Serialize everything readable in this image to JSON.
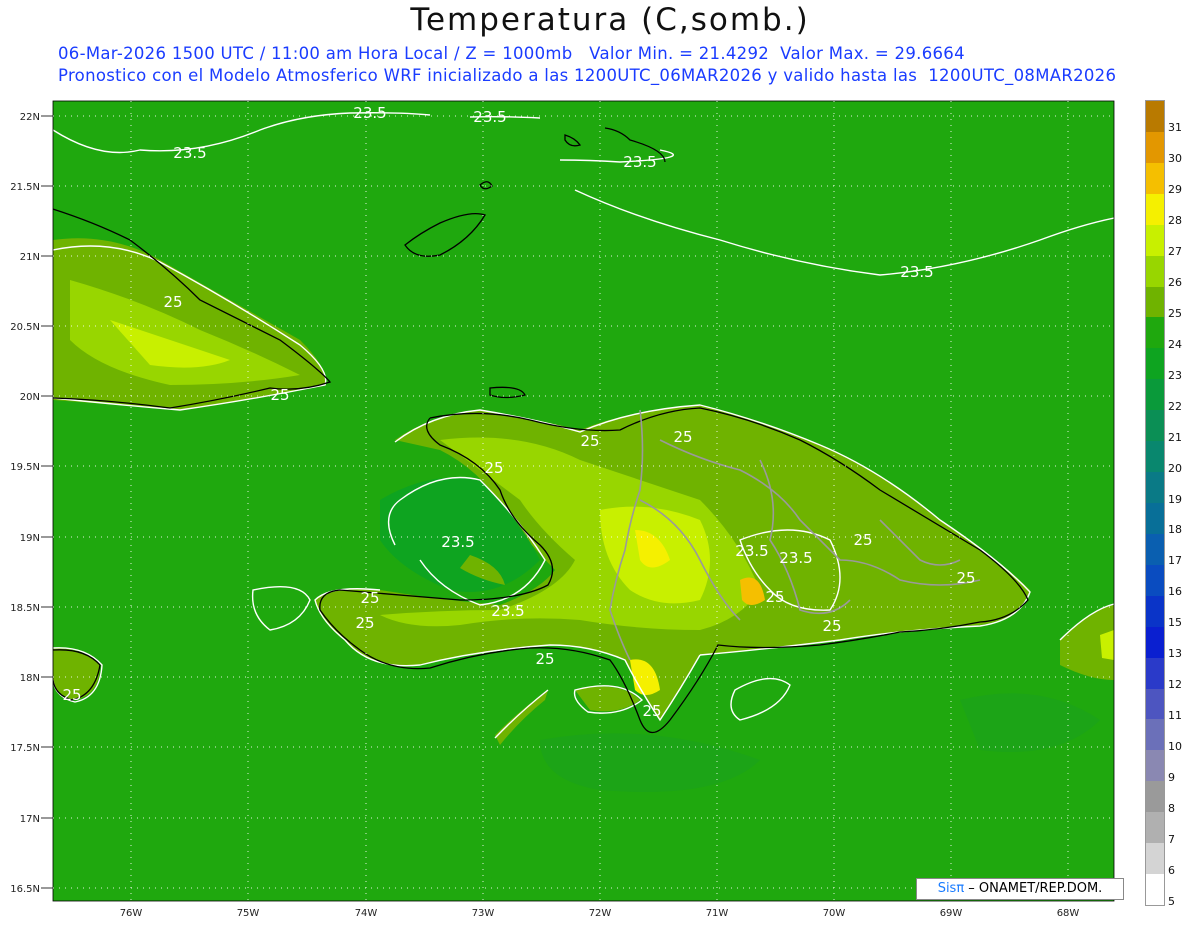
{
  "title": "Temperatura (C,somb.)",
  "subtitle1": "06-Mar-2026 1500 UTC / 11:00 am Hora Local / Z = 1000mb   Valor Min. = 21.4292  Valor Max. = 29.6664",
  "subtitle2": "Pronostico con el Modelo Atmosferico WRF inicializado a las 1200UTC_06MAR2026 y valido hasta las  1200UTC_08MAR2026",
  "credit": {
    "brand": "Sisπ",
    "text": " – ONAMET/REP.DOM."
  },
  "lat_labels": [
    "22N",
    "21.5N",
    "21N",
    "20.5N",
    "20N",
    "19.5N",
    "19N",
    "18.5N",
    "18N",
    "17.5N",
    "17N",
    "16.5N"
  ],
  "lon_labels": [
    "76W",
    "75W",
    "74W",
    "73W",
    "72W",
    "71W",
    "70W",
    "69W",
    "68W"
  ],
  "contour_labels": [
    "23.5",
    "23.5",
    "23.5",
    "23.5",
    "23.5",
    "23.5",
    "23.5",
    "23.5",
    "23.5",
    "25",
    "25",
    "25",
    "25",
    "25",
    "25",
    "25",
    "25",
    "25",
    "25",
    "25",
    "25",
    "25",
    "25"
  ],
  "colorbar": {
    "labels": [
      "31",
      "30",
      "29",
      "28",
      "27",
      "26",
      "25",
      "24",
      "23",
      "22",
      "21",
      "20",
      "19",
      "18",
      "17",
      "16",
      "15",
      "13",
      "12",
      "11",
      "10",
      "9",
      "8",
      "7",
      "6",
      "5"
    ],
    "colors": [
      "#b97a00",
      "#e39700",
      "#f5bf00",
      "#f5f000",
      "#c8f000",
      "#98d600",
      "#6fb300",
      "#1fa80e",
      "#0ea420",
      "#0a9a3a",
      "#0b8f55",
      "#09876e",
      "#0a7a86",
      "#086f98",
      "#0a5fb0",
      "#0a4cc0",
      "#0a34c8",
      "#0a1fd0",
      "#2a3ac9",
      "#4d55c0",
      "#6b70b9",
      "#8a88b2",
      "#9a9a9a",
      "#b0b0b0",
      "#d4d4d4",
      "#ffffff"
    ]
  }
}
